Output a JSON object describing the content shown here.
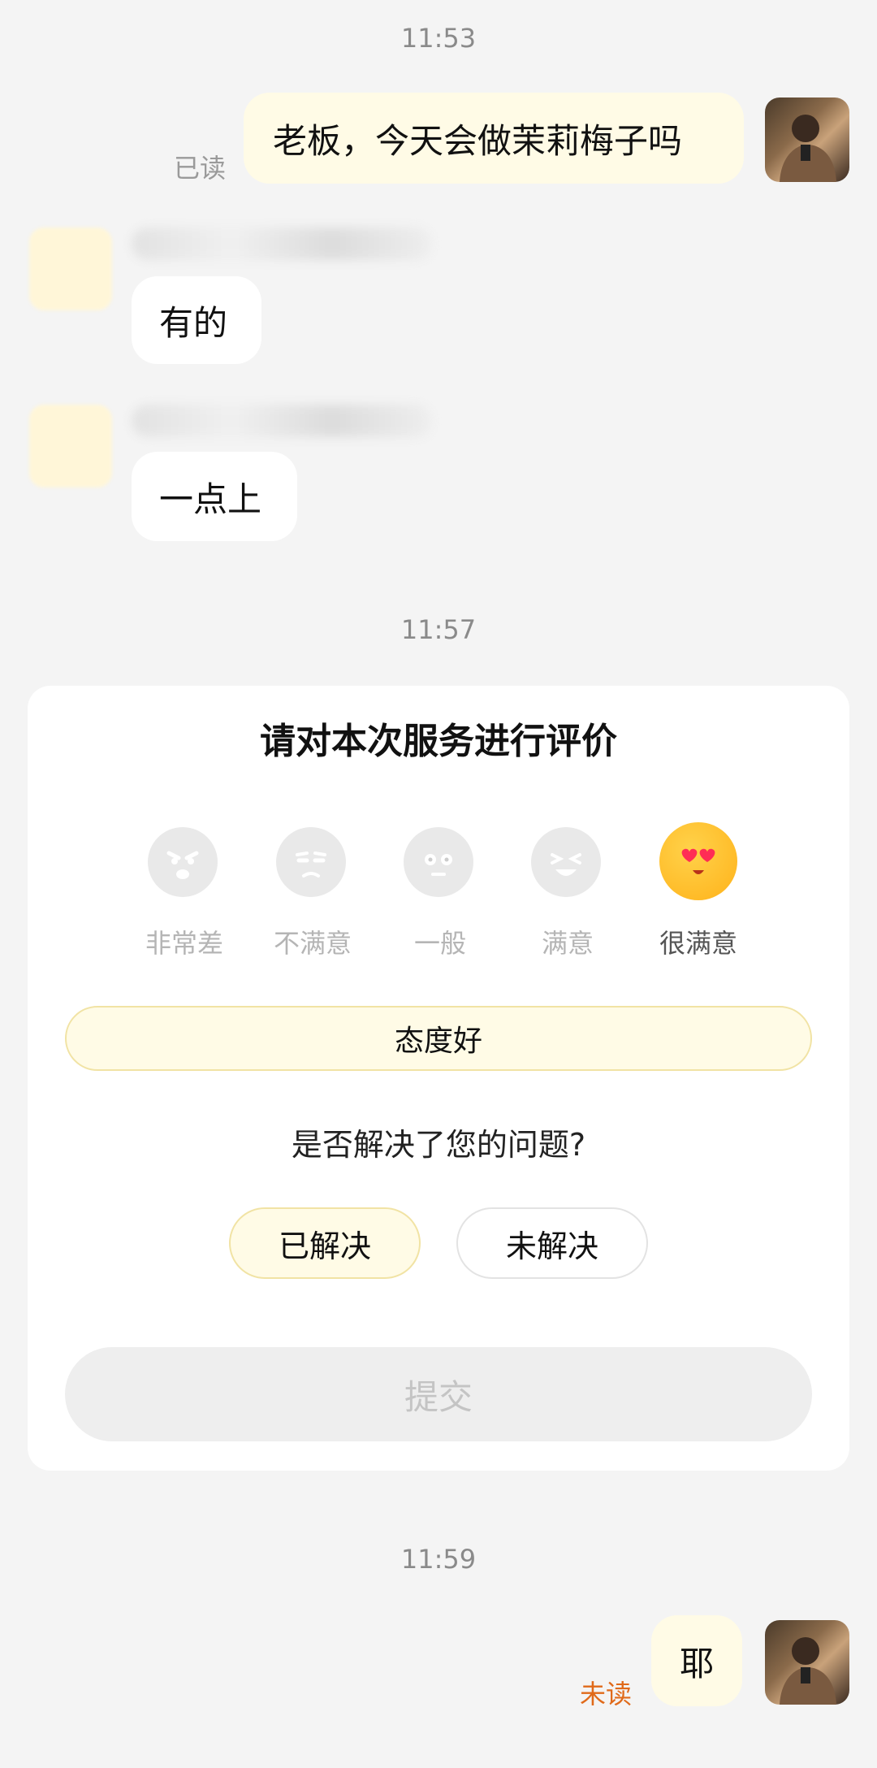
{
  "messages": {
    "time1": "11:53",
    "me1": {
      "text": "老板，今天会做茉莉梅子吗",
      "status": "已读"
    },
    "other1": {
      "text": "有的"
    },
    "other2": {
      "text": "一点上"
    },
    "time2": "11:57",
    "time3": "11:59",
    "me2": {
      "text": "耶",
      "status": "未读"
    }
  },
  "rating_card": {
    "title": "请对本次服务进行评价",
    "options": [
      {
        "label": "非常差",
        "icon": "angry-face-icon"
      },
      {
        "label": "不满意",
        "icon": "unamused-face-icon"
      },
      {
        "label": "一般",
        "icon": "neutral-face-icon"
      },
      {
        "label": "满意",
        "icon": "laughing-face-icon"
      },
      {
        "label": "很满意",
        "icon": "heart-eyes-face-icon"
      }
    ],
    "selected_index": 4,
    "tag": "态度好",
    "question": "是否解决了您的问题?",
    "resolved_label": "已解决",
    "unresolved_label": "未解决",
    "submit_label": "提交"
  },
  "colors": {
    "background": "#f4f4f4",
    "my_bubble": "#fffbe6",
    "unread_status": "#e06a1a",
    "accent_border": "#f1e3a4"
  }
}
